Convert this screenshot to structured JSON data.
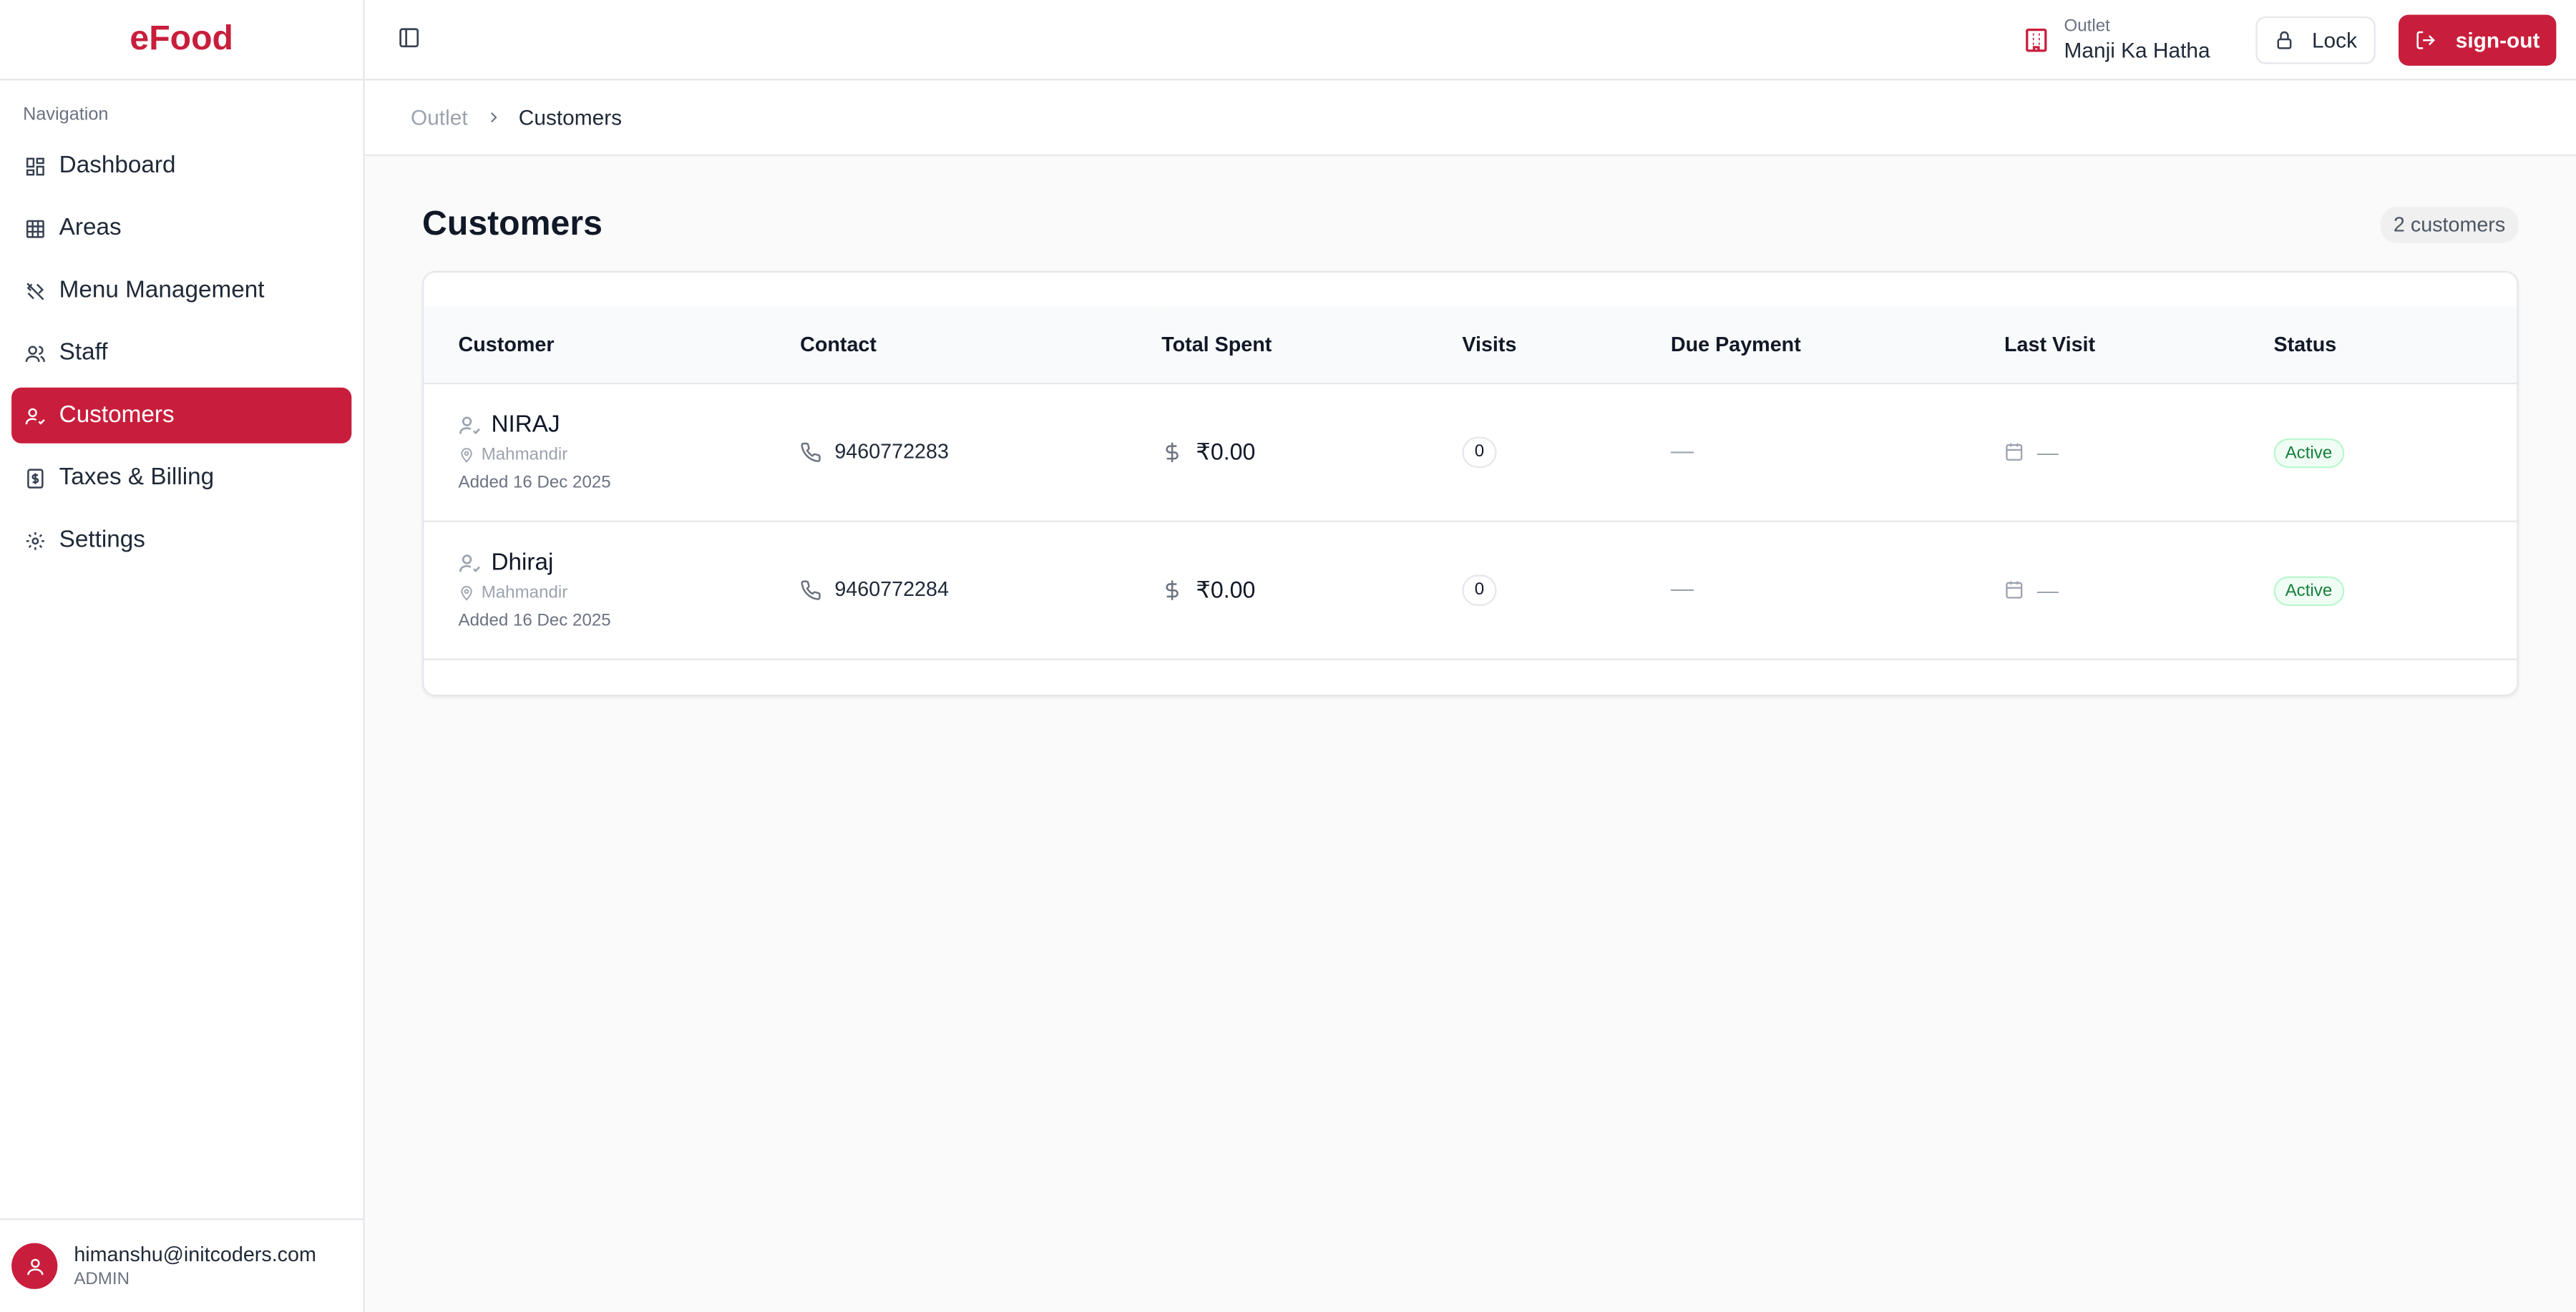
{
  "app": {
    "brand": "eFood"
  },
  "sidebar": {
    "caption": "Navigation",
    "items": [
      {
        "label": "Dashboard",
        "icon": "dashboard-icon"
      },
      {
        "label": "Areas",
        "icon": "grid-icon"
      },
      {
        "label": "Menu Management",
        "icon": "utensils-icon"
      },
      {
        "label": "Staff",
        "icon": "users-icon"
      },
      {
        "label": "Customers",
        "icon": "user-check-icon",
        "active": true
      },
      {
        "label": "Taxes & Billing",
        "icon": "receipt-icon"
      },
      {
        "label": "Settings",
        "icon": "gear-icon"
      }
    ],
    "user": {
      "email": "himanshu@initcoders.com",
      "role": "ADMIN"
    }
  },
  "topbar": {
    "outlet_caption": "Outlet",
    "outlet_name": "Manji Ka Hatha",
    "lock_label": "Lock",
    "signout_label": "sign-out"
  },
  "breadcrumb": {
    "parent": "Outlet",
    "current": "Customers"
  },
  "page": {
    "title": "Customers",
    "count": "2 customers"
  },
  "table": {
    "headers": {
      "customer": "Customer",
      "contact": "Contact",
      "total_spent": "Total Spent",
      "visits": "Visits",
      "due_payment": "Due Payment",
      "last_visit": "Last Visit",
      "status": "Status"
    },
    "rows": [
      {
        "name": "NIRAJ",
        "area": "Mahmandir",
        "added": "Added 16 Dec 2025",
        "phone": "9460772283",
        "spent": "₹0.00",
        "visits": "0",
        "due": "—",
        "last_visit": "—",
        "status": "Active"
      },
      {
        "name": "Dhiraj",
        "area": "Mahmandir",
        "added": "Added 16 Dec 2025",
        "phone": "9460772284",
        "spent": "₹0.00",
        "visits": "0",
        "due": "—",
        "last_visit": "—",
        "status": "Active"
      }
    ]
  },
  "colors": {
    "accent": "#c81e3c",
    "status_active": "#15803d"
  }
}
